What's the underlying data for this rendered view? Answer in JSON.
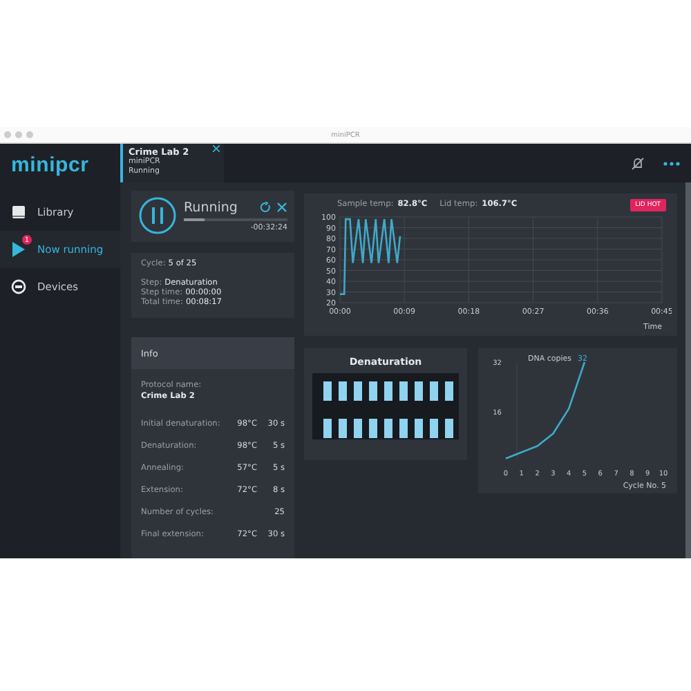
{
  "window": {
    "title": "miniPCR"
  },
  "sidebar": {
    "logo": "minipcr",
    "items": [
      {
        "label": "Library",
        "kind": "book",
        "selected": false
      },
      {
        "label": "Now running",
        "kind": "play",
        "selected": true,
        "badge": "1"
      },
      {
        "label": "Devices",
        "kind": "device",
        "selected": false
      }
    ]
  },
  "tabs": [
    {
      "title": "Crime Lab 2",
      "subtitle": "miniPCR",
      "status": "Running",
      "selected": true
    }
  ],
  "run_status": {
    "state": "Running",
    "level": 0.2,
    "remaining": "-00:32:24"
  },
  "cycle": {
    "cycle_label": "Cycle:",
    "cycle_value": "5 of 25",
    "step_label": "Step:",
    "step_value": "Denaturation",
    "step_time_label": "Step time:",
    "step_time_value": "00:00:00",
    "total_time_label": "Total time:",
    "total_time_value": "00:08:17"
  },
  "info": {
    "title": "Info",
    "protocol_label": "Protocol name:",
    "protocol_name": "Crime Lab 2",
    "rows": [
      {
        "name": "Initial denaturation:",
        "temp": "98°C",
        "time": "30 s"
      },
      {
        "name": "Denaturation:",
        "temp": "98°C",
        "time": "5 s"
      },
      {
        "name": "Annealing:",
        "temp": "57°C",
        "time": "5 s"
      },
      {
        "name": "Extension:",
        "temp": "72°C",
        "time": "8 s"
      },
      {
        "name": "Number of cycles:",
        "time": "25"
      },
      {
        "name": "Final extension:",
        "temp": "72°C",
        "time": "30 s"
      }
    ]
  },
  "temperature": {
    "sample_label": "Sample temp:",
    "sample_value": "82.8°C",
    "lid_label": "Lid temp:",
    "lid_value": "106.7°C",
    "badge": "LID HOT",
    "chart_data": {
      "type": "line",
      "xlabel": "Time",
      "x": [
        0,
        0.6,
        0.8,
        1.4,
        1.8,
        2.6,
        3.2,
        3.6,
        4.4,
        5.0,
        5.4,
        6.2,
        6.8,
        7.2,
        8.0,
        8.4
      ],
      "grid": true,
      "series": [
        {
          "color": "#3fa9c9",
          "values": [
            28,
            28,
            98,
            98,
            57,
            98,
            57,
            98,
            57,
            98,
            57,
            98,
            57,
            98,
            57,
            82
          ]
        }
      ],
      "xlim": [
        0,
        45
      ],
      "ylim": [
        20,
        100
      ],
      "xticks": [
        {
          "value": 0,
          "label": "00:00"
        },
        {
          "value": 9,
          "label": "00:09"
        },
        {
          "value": 18,
          "label": "00:18"
        },
        {
          "value": 27,
          "label": "00:27"
        },
        {
          "value": 36,
          "label": "00:36"
        },
        {
          "value": 45,
          "label": "00:45"
        }
      ],
      "yticks": [
        20,
        30,
        40,
        50,
        60,
        70,
        80,
        90,
        100
      ]
    }
  },
  "denaturation": {
    "title": "Denaturation"
  },
  "dna": {
    "title": "DNA copies",
    "value": "32",
    "chart_data": {
      "type": "line",
      "xlabel": "Cycle No. 5",
      "x": [
        0,
        1,
        2,
        3,
        4,
        5
      ],
      "series": [
        {
          "color": "#3fa9c9",
          "values": [
            1,
            3,
            5,
            9,
            17,
            32
          ]
        }
      ],
      "xlim": [
        0,
        10
      ],
      "ylim": [
        0,
        32
      ],
      "xticks": [
        0,
        1,
        2,
        3,
        4,
        5,
        6,
        7,
        8,
        9,
        10
      ],
      "yticks": [
        16,
        32
      ]
    }
  }
}
